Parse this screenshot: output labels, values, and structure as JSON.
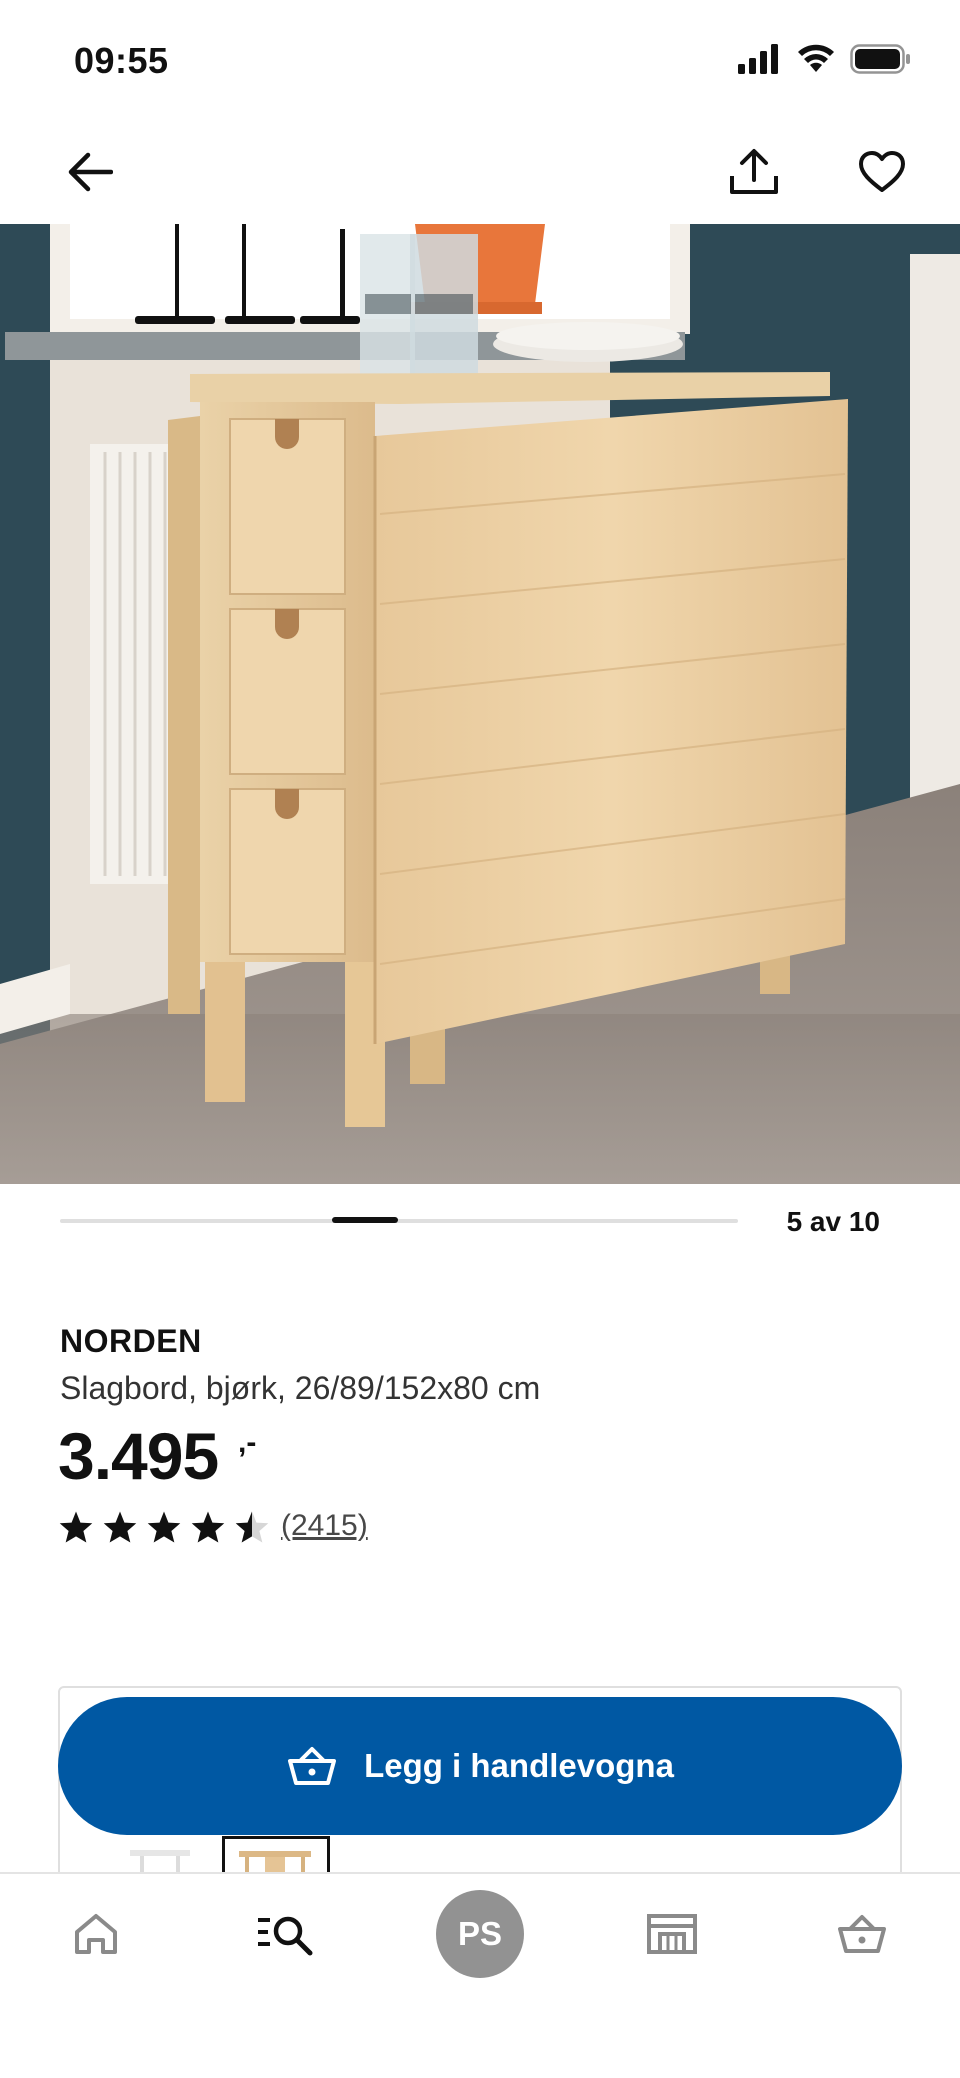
{
  "status_bar": {
    "time": "09:55"
  },
  "header": {
    "back_icon": "arrow-left-icon",
    "share_icon": "share-icon",
    "favorite_icon": "heart-icon"
  },
  "gallery": {
    "counter": "5 av 10",
    "current_index": 5,
    "total": 10
  },
  "product": {
    "name": "NORDEN",
    "description": "Slagbord, bjørk, 26/89/152x80 cm",
    "price": "3.495",
    "price_suffix": ",-",
    "rating": 4.5,
    "rating_max": 5,
    "review_count": "(2415)"
  },
  "cta": {
    "label": "Legg i handlevogna",
    "icon": "shopping-basket-icon",
    "color": "#0058a3"
  },
  "bottom_nav": {
    "items": [
      {
        "icon": "home-icon"
      },
      {
        "icon": "search-list-icon"
      },
      {
        "avatar": "PS"
      },
      {
        "icon": "store-icon"
      },
      {
        "icon": "shopping-basket-icon"
      }
    ]
  }
}
